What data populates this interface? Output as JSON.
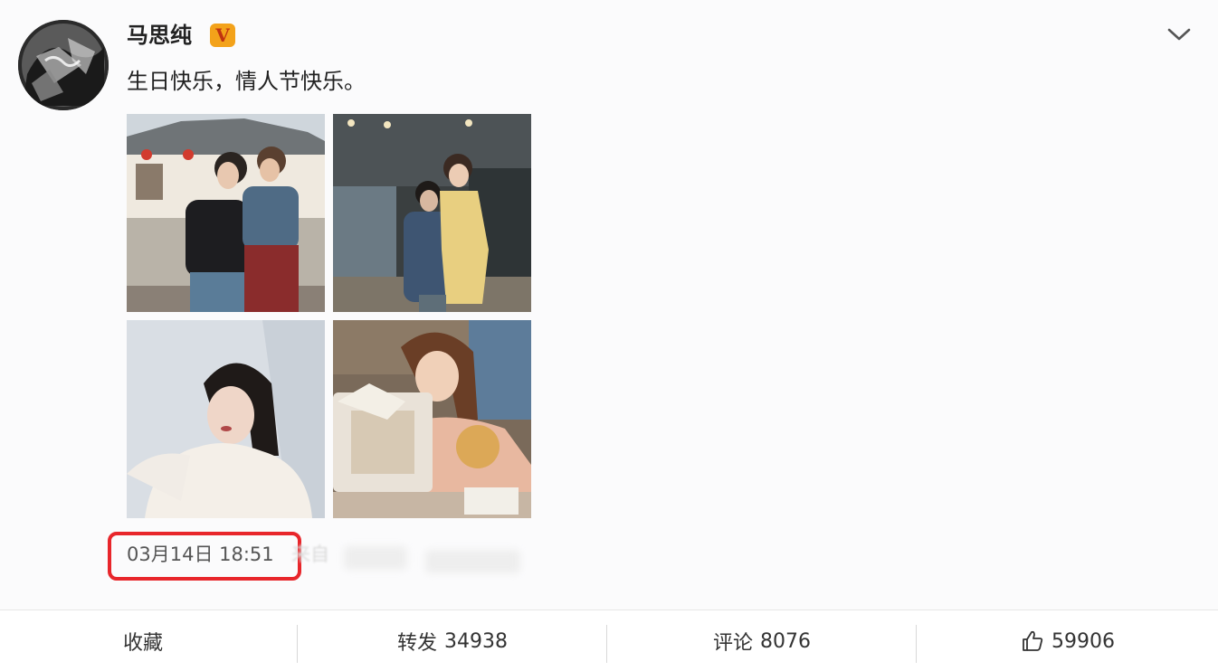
{
  "post": {
    "username": "马思纯",
    "verified_badge": "V",
    "text": "生日快乐，情人节快乐。",
    "timestamp": "03月14日 18:51",
    "source_prefix": "来自",
    "photos": [
      "photo-1",
      "photo-2",
      "photo-3",
      "photo-4"
    ]
  },
  "actions": {
    "collect_label": "收藏",
    "repost_label": "转发",
    "repost_count": "34938",
    "comment_label": "评论",
    "comment_count": "8076",
    "like_count": "59906"
  },
  "icons": {
    "more": "chevron-down-icon",
    "like": "thumbs-up-icon",
    "verified": "verified-v-icon"
  },
  "colors": {
    "highlight": "#e8262b",
    "badge": "#f3a21a",
    "badge_text": "#c0330f"
  }
}
